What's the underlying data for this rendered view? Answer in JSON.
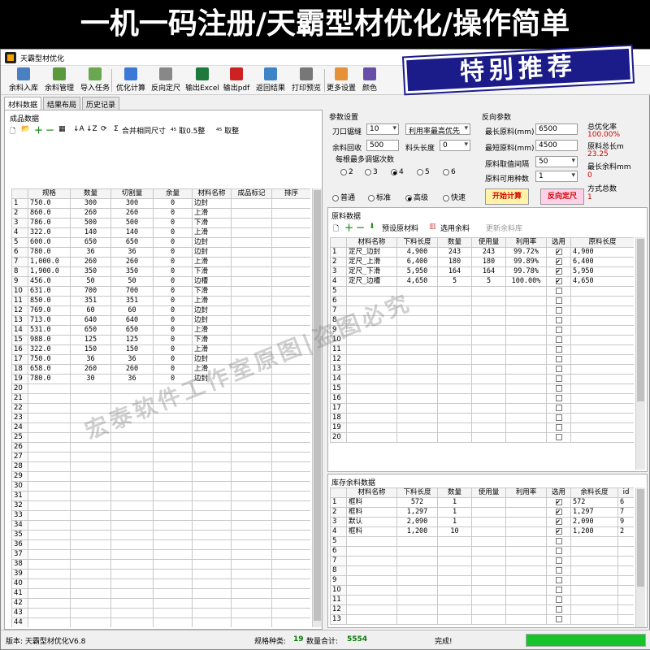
{
  "banner": {
    "text": "一机一码注册/天霸型材优化/操作简单"
  },
  "window": {
    "title": "天霸型材优化"
  },
  "toolbar": {
    "items": [
      {
        "label": "余料入库",
        "icon": "stock-in-icon",
        "color": "#4a7fc1"
      },
      {
        "label": "余料管理",
        "icon": "stock-manage-icon",
        "color": "#5a9a3c"
      },
      {
        "label": "导入任务",
        "icon": "import-task-icon",
        "color": "#6aa84f"
      },
      {
        "label": "优化计算",
        "icon": "optimize-icon",
        "color": "#3c78d8"
      },
      {
        "label": "反向定尺",
        "icon": "reverse-size-icon",
        "color": "#888888"
      },
      {
        "label": "输出Excel",
        "icon": "excel-icon",
        "color": "#1e7a3c"
      },
      {
        "label": "输出pdf",
        "icon": "pdf-icon",
        "color": "#cc2222"
      },
      {
        "label": "返回结果",
        "icon": "return-icon",
        "color": "#3d85c6"
      },
      {
        "label": "打印预览",
        "icon": "print-icon",
        "color": "#777777"
      },
      {
        "label": "更多设置",
        "icon": "settings-icon",
        "color": "#e69138"
      },
      {
        "label": "颜色",
        "icon": "color-icon",
        "color": "#674ea7"
      }
    ]
  },
  "promo": {
    "text": "特别推荐"
  },
  "tabs": [
    {
      "label": "材料数据",
      "active": true
    },
    {
      "label": "结果布局",
      "active": false
    },
    {
      "label": "历史记录",
      "active": false
    }
  ],
  "products": {
    "title": "成品数据",
    "toolbar": {
      "merge": "合并相同尺寸",
      "half": "取0.5整",
      "whole": "取整",
      "sigma": "Σ"
    },
    "columns": [
      "规格",
      "数量",
      "切割量",
      "余量",
      "材料名称",
      "成品标记",
      "排序"
    ],
    "rows": [
      [
        "750.0",
        "300",
        "300",
        "0",
        "边封"
      ],
      [
        "860.0",
        "260",
        "260",
        "0",
        "上滑"
      ],
      [
        "786.0",
        "500",
        "500",
        "0",
        "下滑"
      ],
      [
        "322.0",
        "140",
        "140",
        "0",
        "上滑"
      ],
      [
        "600.0",
        "650",
        "650",
        "0",
        "边封"
      ],
      [
        "780.0",
        "36",
        "36",
        "0",
        "边封"
      ],
      [
        "1,000.0",
        "260",
        "260",
        "0",
        "上滑"
      ],
      [
        "1,900.0",
        "350",
        "350",
        "0",
        "下滑"
      ],
      [
        "456.0",
        "50",
        "50",
        "0",
        "边槽"
      ],
      [
        "631.0",
        "700",
        "700",
        "0",
        "下滑"
      ],
      [
        "850.0",
        "351",
        "351",
        "0",
        "上滑"
      ],
      [
        "769.0",
        "60",
        "60",
        "0",
        "边封"
      ],
      [
        "713.0",
        "640",
        "640",
        "0",
        "边封"
      ],
      [
        "531.0",
        "650",
        "650",
        "0",
        "上滑"
      ],
      [
        "988.0",
        "125",
        "125",
        "0",
        "下滑"
      ],
      [
        "322.0",
        "150",
        "150",
        "0",
        "上滑"
      ],
      [
        "750.0",
        "36",
        "36",
        "0",
        "边封"
      ],
      [
        "658.0",
        "260",
        "260",
        "0",
        "上滑"
      ],
      [
        "780.0",
        "30",
        "36",
        "0",
        "边封"
      ]
    ],
    "total_rows": 45
  },
  "params": {
    "title": "参数设置",
    "kerf_label": "刀口锯缝",
    "kerf_value": "10",
    "priority_value": "利用率最高优先",
    "recycle_label": "余料回收",
    "recycle_value": "500",
    "head_label": "料头长度",
    "head_value": "0",
    "repeat_title": "每根最多调锯次数",
    "repeat_options": [
      "2",
      "3",
      "4",
      "5",
      "6"
    ],
    "repeat_selected": "4",
    "levels": [
      "普通",
      "标准",
      "高级",
      "快速"
    ],
    "level_selected": "高级"
  },
  "reverse": {
    "title": "反向参数",
    "max_label": "最长原料(mm)",
    "max_value": "6500",
    "min_label": "最短原料(mm)",
    "min_value": "4500",
    "interval_label": "原料取值间隔",
    "interval_value": "50",
    "kinds_label": "原料可用种数",
    "kinds_value": "1",
    "start_button": "开始计算",
    "reverse_button": "反向定尺"
  },
  "summary": {
    "rate_label": "总优化率",
    "rate_value": "100.00%",
    "total_label": "原料总长m",
    "total_value": "23.25",
    "maxrem_label": "最长余料mm",
    "maxrem_value": "0",
    "count_label": "方式总数",
    "count_value": "1"
  },
  "raw": {
    "title": "原料数据",
    "toolbar": {
      "preset": "预设原材料",
      "select": "选用余料",
      "update": "更新余料库"
    },
    "columns": [
      "材料名称",
      "下料长度",
      "数量",
      "使用量",
      "利用率",
      "选用",
      "原料长度"
    ],
    "rows": [
      [
        "定尺_边封",
        "4,900",
        "243",
        "243",
        "99.72%",
        true,
        "4,900"
      ],
      [
        "定尺_上滑",
        "6,400",
        "180",
        "180",
        "99.89%",
        true,
        "6,400"
      ],
      [
        "定尺_下滑",
        "5,950",
        "164",
        "164",
        "99.78%",
        true,
        "5,950"
      ],
      [
        "定尺_边槽",
        "4,650",
        "5",
        "5",
        "100.00%",
        true,
        "4,650"
      ]
    ],
    "total_rows": 20
  },
  "stock": {
    "title": "库存余料数据",
    "columns": [
      "材料名称",
      "下料长度",
      "数量",
      "使用量",
      "利用率",
      "选用",
      "余料长度",
      "id"
    ],
    "rows": [
      [
        "框料",
        "572",
        "1",
        "",
        "",
        true,
        "572",
        "6"
      ],
      [
        "框料",
        "1,297",
        "1",
        "",
        "",
        true,
        "1,297",
        "7"
      ],
      [
        "默认",
        "2,090",
        "1",
        "",
        "",
        true,
        "2,090",
        "9"
      ],
      [
        "框料",
        "1,200",
        "10",
        "",
        "",
        true,
        "1,200",
        "2"
      ]
    ],
    "total_rows": 13
  },
  "watermark": {
    "text": "宏泰软件工作室原图|盗图必究"
  },
  "status": {
    "version": "版本: 天霸型材优化V6.8",
    "kinds_label": "规格种类:",
    "kinds_value": "19",
    "qty_label": "数量合计:",
    "qty_value": "5554",
    "done": "完成!",
    "progress": 1.0,
    "progress_color": "#18c22a"
  }
}
